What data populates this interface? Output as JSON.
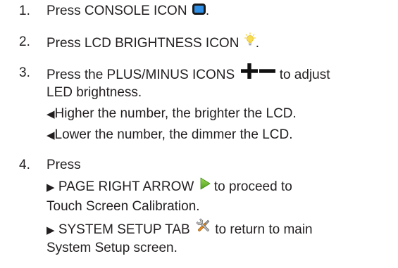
{
  "steps": [
    {
      "number": "1.",
      "before": "Press CONSOLE ICON",
      "after": "."
    },
    {
      "number": "2.",
      "before": "Press LCD BRIGHTNESS ICON",
      "after": "."
    },
    {
      "number": "3.",
      "before": "Press the PLUS/MINUS ICONS",
      "after": "to adjust",
      "continuation": "LED brightness.",
      "notes": [
        "Higher the number, the brighter the LCD.",
        "Lower the number, the dimmer the LCD."
      ]
    },
    {
      "number": "4.",
      "text": "Press",
      "options": [
        {
          "before": "PAGE RIGHT ARROW",
          "after": "to proceed to",
          "continuation": "Touch Screen Calibration."
        },
        {
          "before": "SYSTEM SETUP TAB",
          "after": "to return to main",
          "continuation": "System Setup screen."
        }
      ]
    }
  ],
  "icons": {
    "console": "console-icon",
    "brightness": "lightbulb-icon",
    "plus": "plus-icon",
    "minus": "minus-icon",
    "page_right": "arrow-right-icon",
    "system_setup": "tools-icon",
    "bullet_left": "triangle-left-icon",
    "bullet_right": "triangle-right-icon"
  },
  "colors": {
    "text": "#231f20",
    "console_icon_fill": "#2f8fe6",
    "console_icon_border": "#1a1a1a",
    "bulb": "#f5d23a",
    "arrow": "#6fbe2e",
    "plus_minus": "#111111"
  }
}
